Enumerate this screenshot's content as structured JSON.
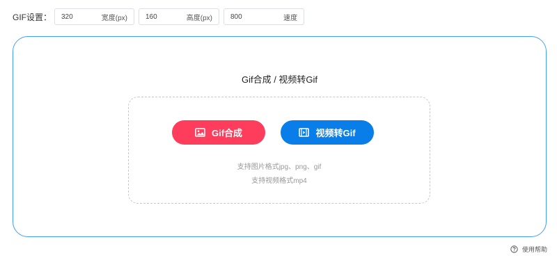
{
  "settings": {
    "label": "GIF设置：",
    "width": {
      "value": "320",
      "unit": "宽度(px)"
    },
    "height": {
      "value": "160",
      "unit": "高度(px)"
    },
    "speed": {
      "value": "800",
      "unit": "速度"
    }
  },
  "main": {
    "title": "Gif合成 / 视频转Gif",
    "buttons": {
      "gif_label": "Gif合成",
      "video_label": "视频转Gif"
    },
    "hints": {
      "image_formats": "支持图片格式jpg、png、gif",
      "video_formats": "支持视频格式mp4"
    }
  },
  "help": {
    "label": "使用帮助"
  },
  "colors": {
    "accent_border": "#409eff",
    "gif_button": "#fd3d5b",
    "video_button": "#0a7ee8"
  },
  "icons": {
    "gif_button_icon": "image-icon",
    "video_button_icon": "film-icon",
    "help_icon": "question-circle-icon"
  }
}
